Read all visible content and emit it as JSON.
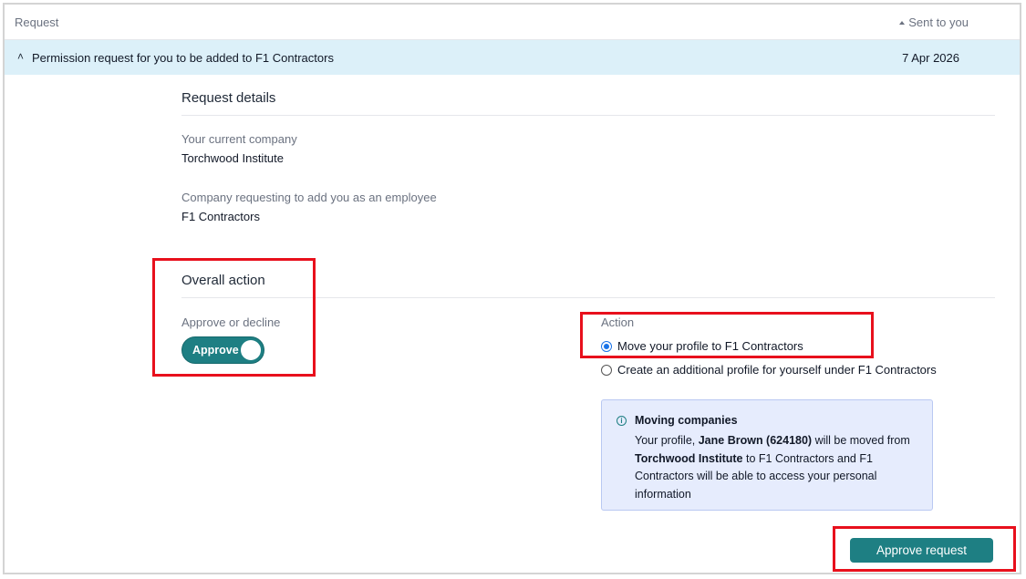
{
  "table": {
    "col_request": "Request",
    "col_sent": "Sent to you"
  },
  "row": {
    "title": "Permission request for you to be added to F1 Contractors",
    "date": "7 Apr 2026"
  },
  "details": {
    "section_title": "Request details",
    "current_company_label": "Your current company",
    "current_company_value": "Torchwood Institute",
    "requesting_company_label": "Company requesting to add you as an employee",
    "requesting_company_value": "F1 Contractors"
  },
  "overall": {
    "section_title": "Overall action",
    "approve_label": "Approve or decline",
    "toggle_text": "Approve",
    "action_label": "Action",
    "options": [
      {
        "label": "Move your profile to F1 Contractors",
        "checked": true
      },
      {
        "label": "Create an additional profile for yourself under F1 Contractors",
        "checked": false
      }
    ]
  },
  "info": {
    "icon": "info-icon",
    "title": "Moving companies",
    "body_pre": "Your profile, ",
    "body_name": "Jane Brown (624180)",
    "body_mid": " will be moved from ",
    "body_company": "Torchwood Institute",
    "body_post": " to F1 Contractors and F1 Contractors will be able to access your personal information"
  },
  "footer": {
    "approve_button": "Approve request"
  },
  "colors": {
    "accent": "#1e7f83",
    "row_highlight": "#dcf0f9",
    "info_bg": "#e6ecfd",
    "annotation_red": "#e8101c"
  }
}
